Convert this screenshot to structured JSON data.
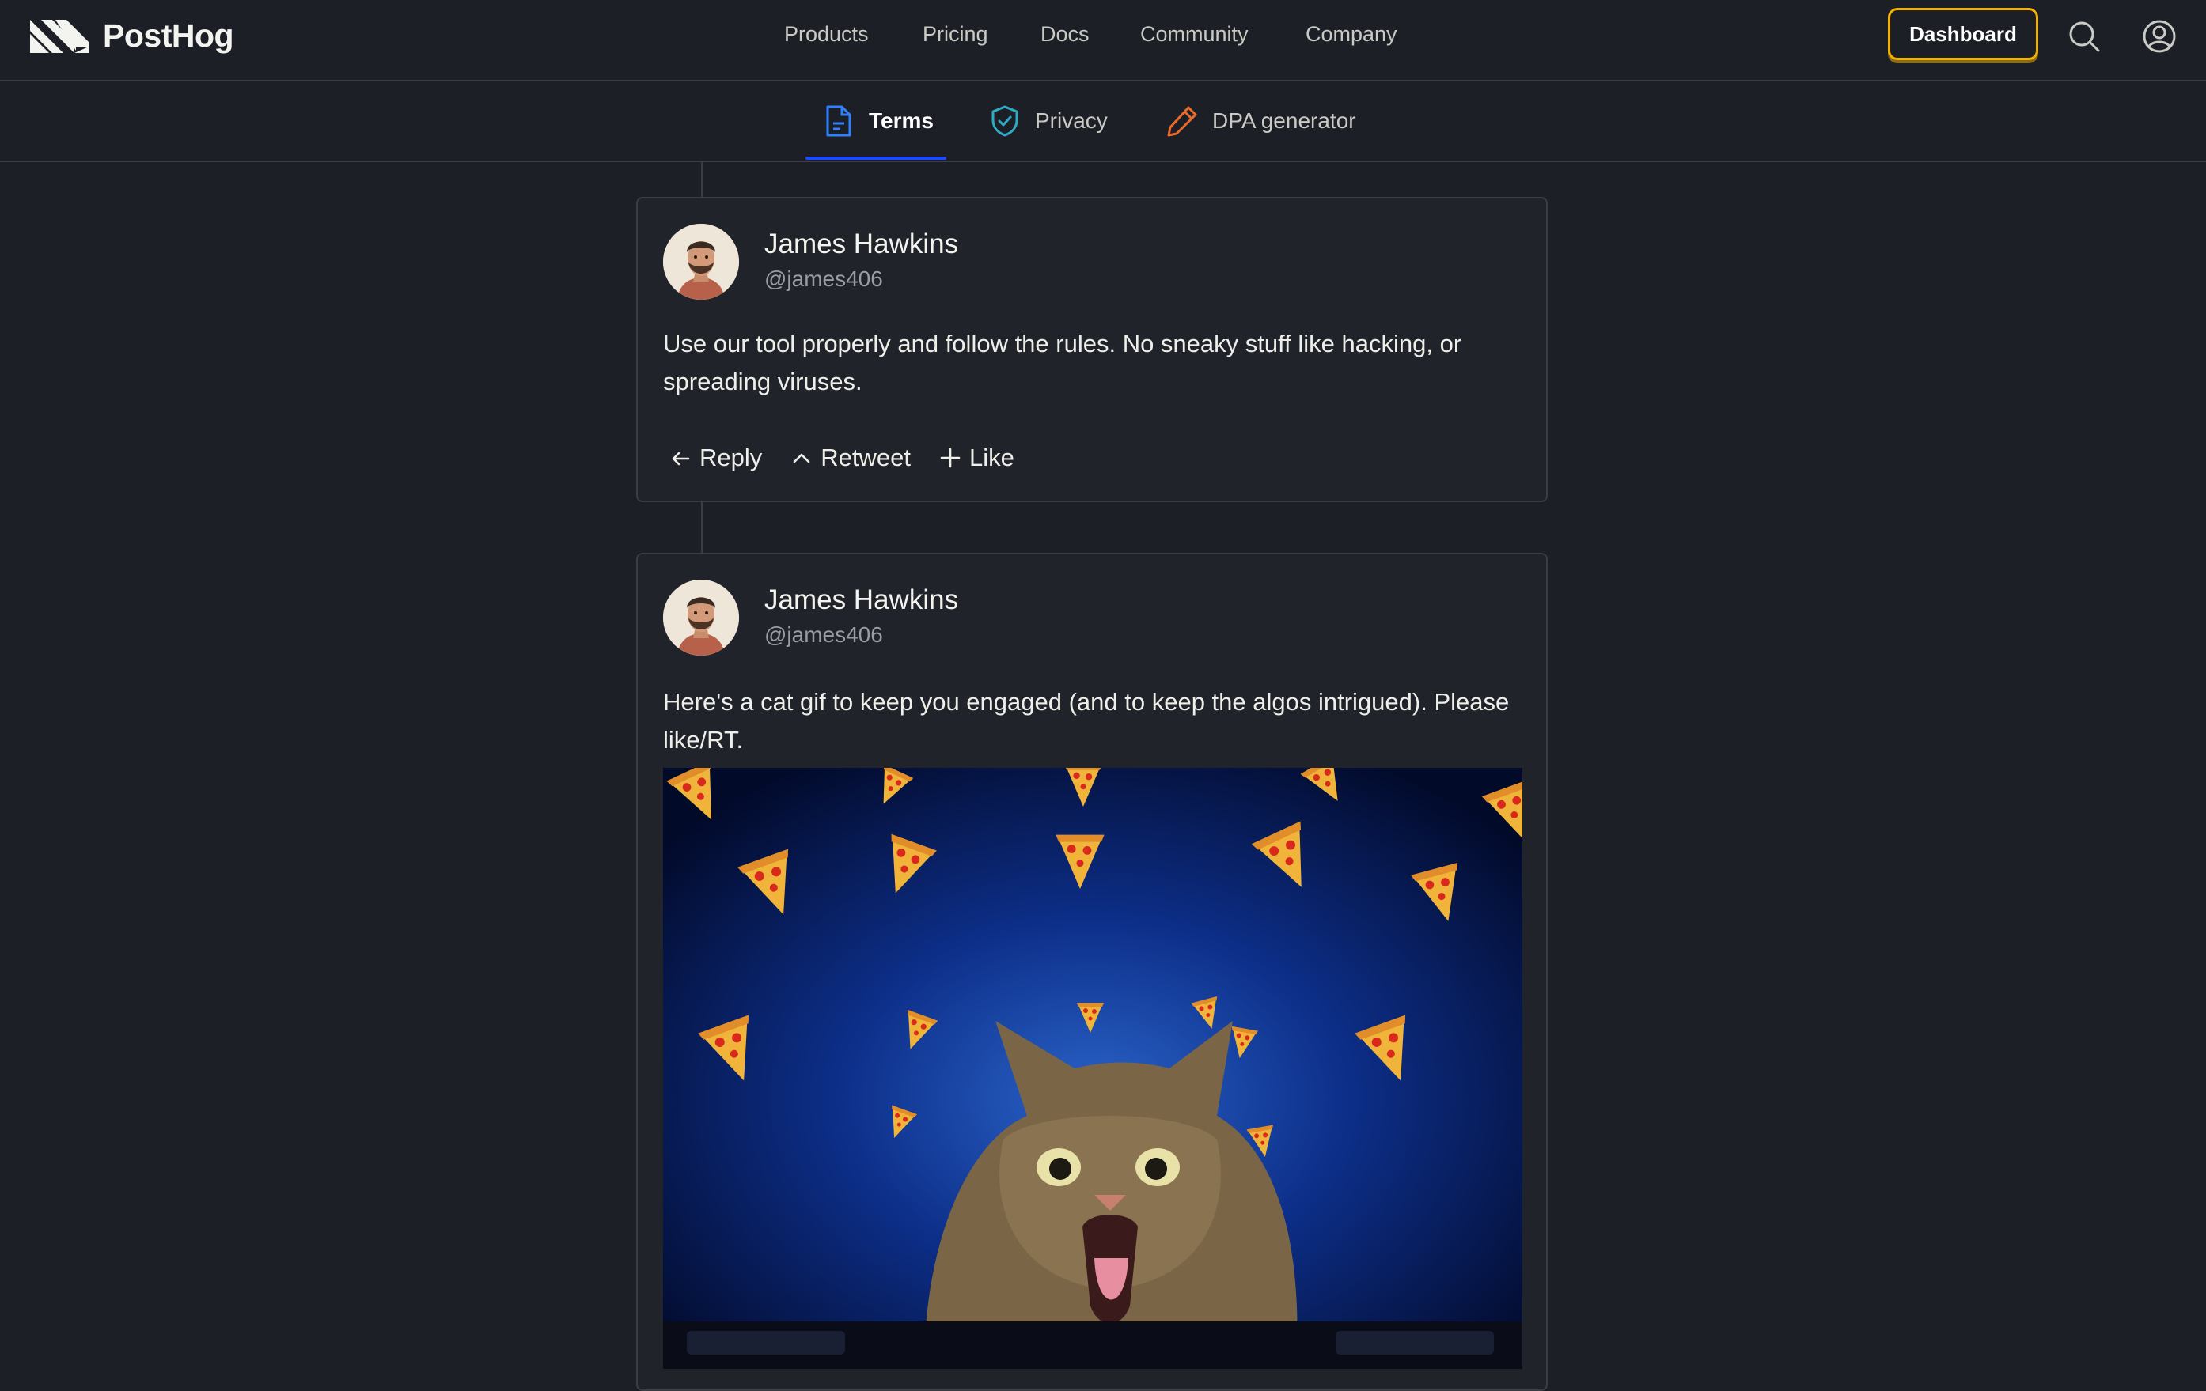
{
  "brand": {
    "name": "PostHog"
  },
  "nav": {
    "items": [
      "Products",
      "Pricing",
      "Docs",
      "Community",
      "Company"
    ],
    "dashboard_label": "Dashboard"
  },
  "subnav": {
    "tabs": [
      {
        "label": "Terms",
        "icon": "document-icon",
        "active": true
      },
      {
        "label": "Privacy",
        "icon": "shield-check-icon",
        "active": false
      },
      {
        "label": "DPA generator",
        "icon": "pencil-icon",
        "active": false
      }
    ]
  },
  "tweets": [
    {
      "author": "James Hawkins",
      "handle": "@james406",
      "text": "Use our tool properly and follow the rules. No sneaky stuff like hacking, or spreading viruses.",
      "actions": [
        "Reply",
        "Retweet",
        "Like"
      ]
    },
    {
      "author": "James Hawkins",
      "handle": "@james406",
      "text": "Here's a cat gif to keep you engaged (and to keep the algos intrigued). Please like/RT.",
      "image": "pizza-cat-gif"
    }
  ],
  "colors": {
    "background": "#1d1f27",
    "border": "#3a3d45",
    "accent_yellow": "#f5b300",
    "accent_blue": "#1d4aff",
    "terms_icon": "#2f80fa",
    "privacy_icon": "#30abc6",
    "dpa_icon": "#eb6a2a"
  }
}
